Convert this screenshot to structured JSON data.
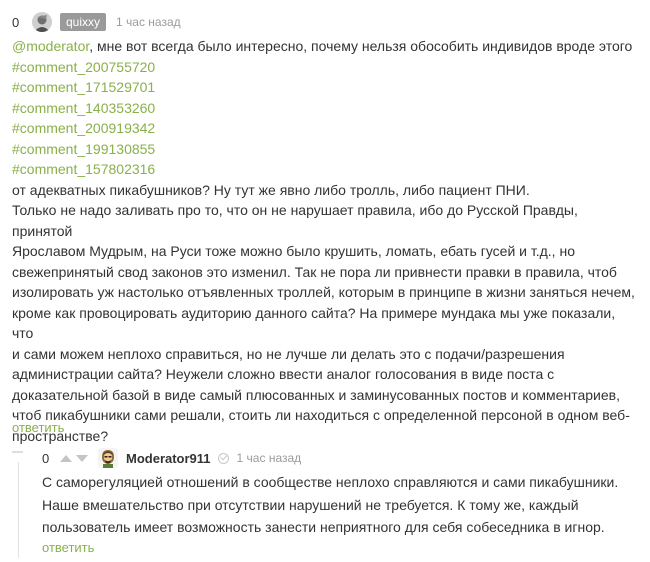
{
  "comment1": {
    "rating": "0",
    "username": "quixxy",
    "time": "1 час назад",
    "mention": "@moderator",
    "intro": ", мне вот всегда было интересно, почему нельзя обособить индивидов вроде этого",
    "tags": [
      "#comment_200755720",
      "#comment_171529701",
      "#comment_140353260",
      "#comment_200919342",
      "#comment_199130855",
      "#comment_157802316"
    ],
    "lines": [
      "от адекватных пикабушников? Ну тут же явно либо тролль, либо пациент ПНИ.",
      "Только не надо заливать про то, что он не нарушает правила, ибо до Русской Правды, принятой",
      "Ярославом Мудрым, на Руси тоже можно было крушить, ломать, ебать гусей и т.д., но",
      "свежепринятый свод законов это изменил. Так не пора ли привнести правки в правила, чтоб",
      "изолировать уж настолько отъявленных троллей, которым в принципе в жизни заняться нечем,",
      "кроме как провоцировать аудиторию данного сайта? На примере мундака мы уже показали, что",
      "и сами можем неплохо справиться, но не лучше ли делать это с подачи/разрешения",
      "администрации сайта? Неужели сложно ввести аналог голосования в виде поста с",
      "доказательной базой в виде самый плюсованных и заминусованных постов и комментариев,",
      "чтоб пикабушники сами решали, стоить ли находиться с определенной персоной в одном веб-",
      "пространстве?"
    ],
    "reply_label": "ответить"
  },
  "comment2": {
    "rating": "0",
    "username": "Moderator911",
    "time": "1 час назад",
    "lines": [
      "С саморегуляцией отношений в сообществе неплохо справляются и сами пикабушники.",
      "Наше вмешательство при отсутствии нарушений не требуется. К тому же, каждый",
      "пользователь имеет возможность занести неприятного для себя собеседника в игнор."
    ],
    "reply_label": "ответить"
  },
  "colors": {
    "link_green": "#8ab04a",
    "badge_gray": "#9a9a9a",
    "muted_text": "#9b9b9b"
  },
  "icons": [
    "avatar",
    "upvote-arrow-icon",
    "downvote-arrow-icon",
    "moderator-check-icon"
  ]
}
